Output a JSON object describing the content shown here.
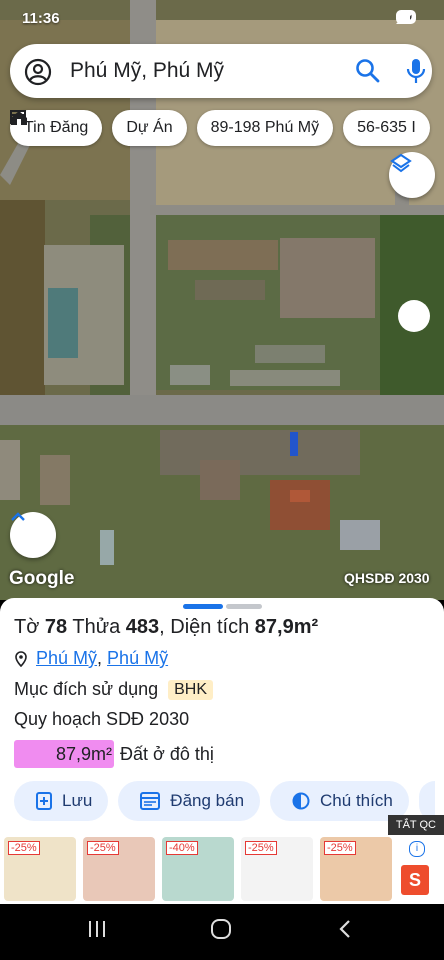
{
  "status": {
    "time": "11:36",
    "battery": "89"
  },
  "search": {
    "query": "Phú Mỹ, Phú Mỹ"
  },
  "chips": [
    {
      "label": "Tin Đăng",
      "icon": "listing-icon"
    },
    {
      "label": "Dự Án",
      "icon": "project-icon"
    },
    {
      "label": "89-198 Phú Mỹ",
      "icon": ""
    },
    {
      "label": "56-635 I",
      "icon": ""
    }
  ],
  "map": {
    "attribution": "Google",
    "layer_label": "QHSDĐ 2030"
  },
  "detail": {
    "to_label": "Tờ",
    "to_value": "78",
    "thua_label": "Thửa",
    "thua_value": "483",
    "dientich_label": ", Diện tích",
    "dientich_value": "87,9m²",
    "location_part1": "Phú Mỹ",
    "location_sep": ",",
    "location_part2": "Phú Mỹ",
    "purpose_label": "Mục đích sử dụng",
    "purpose_value": "BHK",
    "plan_label": "Quy hoạch SDĐ 2030",
    "area_value": "87,9m²",
    "area_type": "Đất ở đô thị",
    "area_color": "#f08cf0"
  },
  "actions": [
    {
      "label": "Lưu"
    },
    {
      "label": "Đăng bán"
    },
    {
      "label": "Chú thích"
    }
  ],
  "ad": {
    "tag": "TẮT QC",
    "products": [
      {
        "discount": "-25%"
      },
      {
        "discount": "-25%"
      },
      {
        "discount": "-40%"
      },
      {
        "discount": "-25%"
      },
      {
        "discount": "-25%"
      }
    ],
    "info": "i",
    "shop_letter": "S"
  },
  "colors": {
    "accent": "#1a73e8",
    "action_bg": "#e8f0fe",
    "badge_bg": "#ffeec6"
  }
}
